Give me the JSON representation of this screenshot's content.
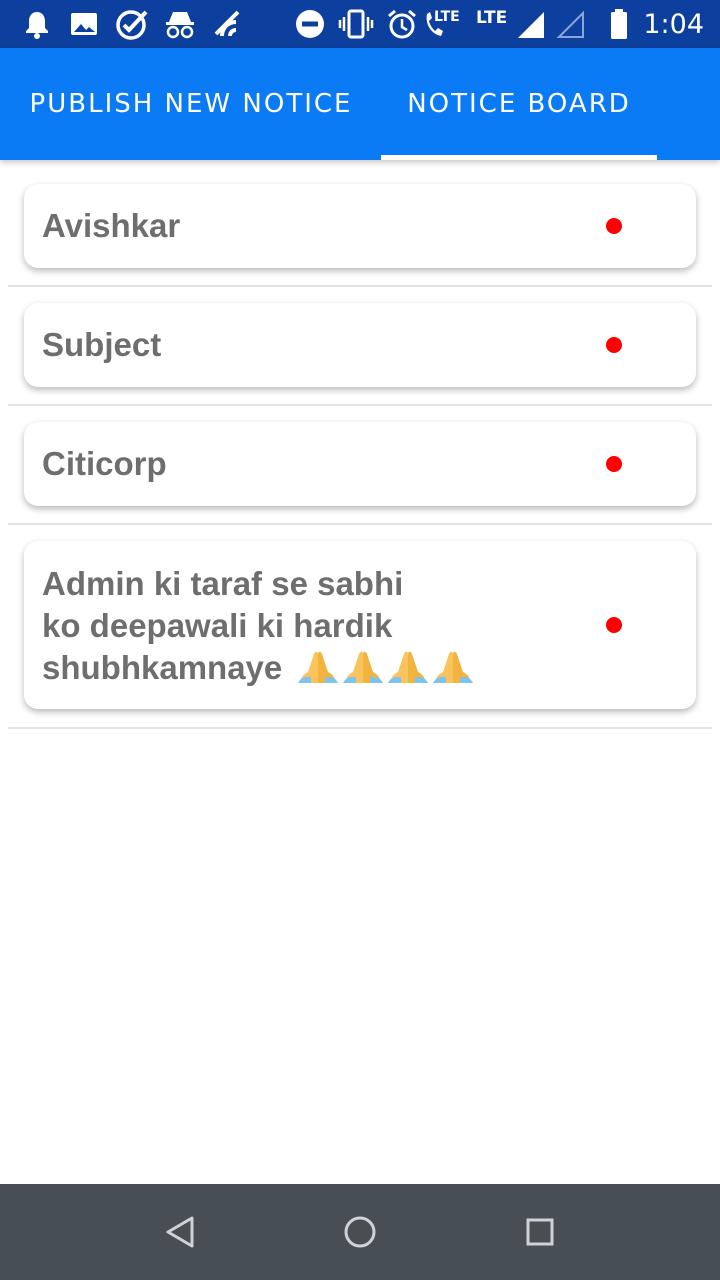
{
  "status_bar": {
    "time": "1:04",
    "lte_call_label": "LTE",
    "lte_data_label": "LTE",
    "icons": [
      "notification-bell-icon",
      "image-icon",
      "check-circle-icon",
      "incognito-icon",
      "signal-off-icon",
      "do-not-disturb-icon",
      "vibrate-icon",
      "alarm-icon",
      "wifi-call-icon",
      "signal-full-icon",
      "signal-empty-icon",
      "battery-icon"
    ]
  },
  "tabs": [
    {
      "label": "PUBLISH NEW NOTICE",
      "selected": false
    },
    {
      "label": "NOTICE BOARD",
      "selected": true
    }
  ],
  "notices": [
    {
      "title": "Avishkar",
      "unread": true
    },
    {
      "title": "Subject",
      "unread": true
    },
    {
      "title": "Citicorp",
      "unread": true
    },
    {
      "title": "Admin ki taraf se sabhi\nko deepawali ki hardik\nshubhkamnaye",
      "emoji": "folded-hands",
      "emoji_count": 4,
      "unread": true
    }
  ],
  "nav_bar": {
    "buttons": [
      "back-icon",
      "home-icon",
      "recents-icon"
    ]
  },
  "colors": {
    "status_bar": "#0d3f9e",
    "app_bar": "#0a7bf4",
    "notice_text": "#6e6e6e",
    "unread_dot": "#ff0000",
    "nav_bar": "#474e54"
  }
}
